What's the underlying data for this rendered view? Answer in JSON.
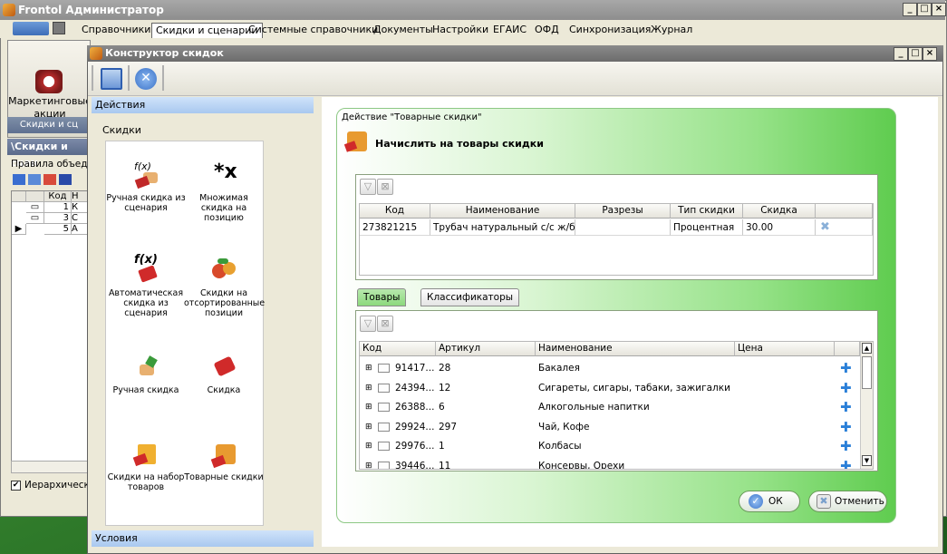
{
  "app": {
    "title": "Frontol Администратор"
  },
  "menu": [
    "Справочники",
    "Скидки и сценарии",
    "Системные справочники",
    "Документы",
    "Настройки",
    "ЕГАИС",
    "ОФД",
    "Синхронизация",
    "Журнал"
  ],
  "ribbon": {
    "label1": "Маркетинговые",
    "label2": "акции",
    "group": "Скидки и сц"
  },
  "left_panel": {
    "header": "\\Скидки и сцен",
    "group_title": "Правила объеди",
    "col_code": "Код",
    "col_name": "Н",
    "rows": [
      {
        "code": "1",
        "name": "К"
      },
      {
        "code": "3",
        "name": "С"
      },
      {
        "code": "5",
        "name": "А"
      }
    ],
    "checkbox_label": "Иерархическ"
  },
  "dialog": {
    "title": "Конструктор скидок"
  },
  "actions_panel": {
    "header": "Действия",
    "section": "Скидки",
    "footer": "Условия",
    "items": [
      {
        "label": "Ручная скидка из сценария"
      },
      {
        "label": "Множимая скидка на позицию"
      },
      {
        "label": "Автоматическая скидка из сценария"
      },
      {
        "label": "Скидки на отсортированные позиции"
      },
      {
        "label": "Ручная скидка"
      },
      {
        "label": "Скидка"
      },
      {
        "label": "Скидки на набор товаров"
      },
      {
        "label": "Товарные скидки"
      }
    ]
  },
  "action_detail": {
    "group_title": "Действие \"Товарные скидки\"",
    "heading": "Начислить на товары скидки"
  },
  "discount_table": {
    "columns": [
      "Код",
      "Наименование",
      "Разрезы",
      "Тип скидки",
      "Скидка"
    ],
    "rows": [
      {
        "code": "273821215",
        "name": "Трубач натуральный с/с ж/б 2...",
        "sections": "",
        "type": "Процентная",
        "discount": "30.00"
      }
    ]
  },
  "tabs": [
    {
      "label": "Товары",
      "active": true
    },
    {
      "label": "Классификаторы",
      "active": false
    }
  ],
  "goods_table": {
    "columns": [
      "Код",
      "Артикул",
      "Наименование",
      "Цена"
    ],
    "rows": [
      {
        "code": "91417...",
        "article": "28",
        "name": "Бакалея",
        "price": ""
      },
      {
        "code": "24394...",
        "article": "12",
        "name": "Сигареты, сигары, табаки, зажигалки",
        "price": ""
      },
      {
        "code": "26388...",
        "article": "6",
        "name": "Алкогольные напитки",
        "price": ""
      },
      {
        "code": "29924...",
        "article": "297",
        "name": "Чай, Кофе",
        "price": ""
      },
      {
        "code": "29976...",
        "article": "1",
        "name": "Колбасы",
        "price": ""
      },
      {
        "code": "39446...",
        "article": "11",
        "name": "Консервы, Орехи",
        "price": ""
      }
    ]
  },
  "buttons": {
    "ok": "ОК",
    "cancel": "Отменить"
  },
  "colors": {
    "accent_green": "#5fcc4f",
    "plus_blue": "#2a7fd8"
  }
}
